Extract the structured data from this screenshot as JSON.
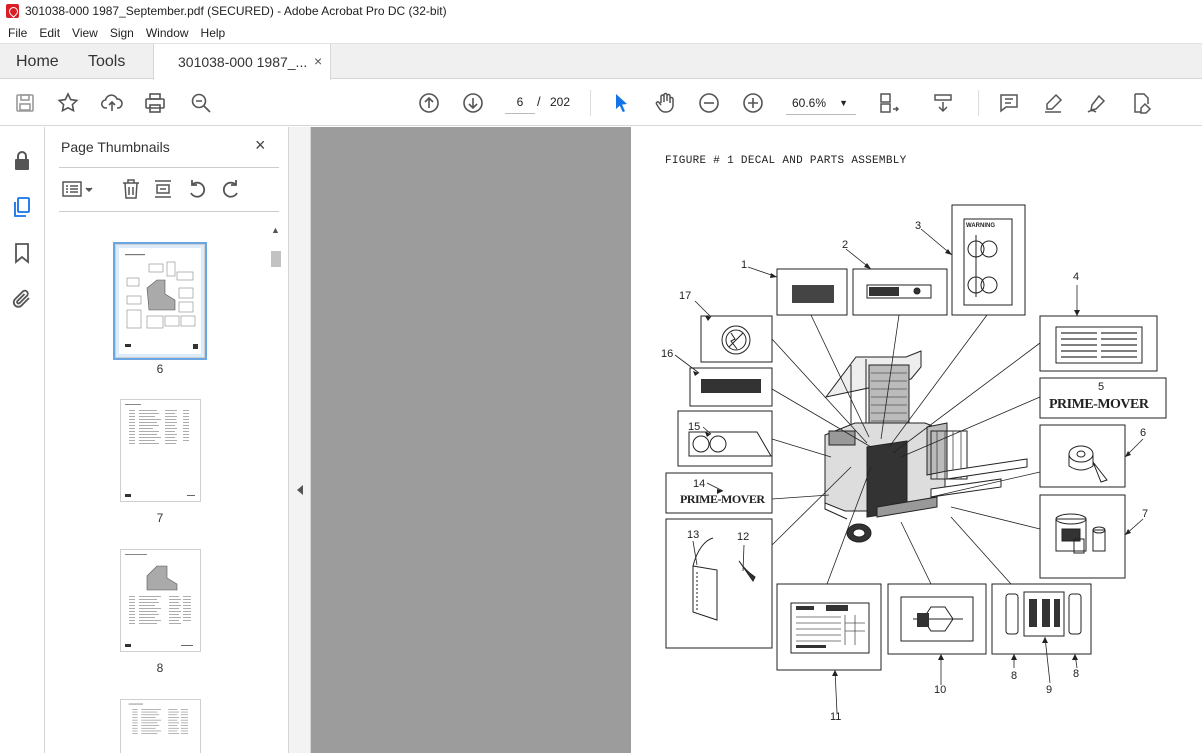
{
  "window": {
    "title": "301038-000 1987_September.pdf (SECURED) - Adobe Acrobat Pro DC (32-bit)"
  },
  "menu": [
    "File",
    "Edit",
    "View",
    "Sign",
    "Window",
    "Help"
  ],
  "tabs": {
    "home": "Home",
    "tools": "Tools",
    "document": "301038-000 1987_...",
    "close": "×"
  },
  "toolbar": {
    "page_current": "6",
    "page_separator": "/",
    "page_total": "202",
    "zoom": "60.6%"
  },
  "thumbnails_panel": {
    "title": "Page Thumbnails",
    "close": "×",
    "pages": [
      {
        "label": "6",
        "selected": true
      },
      {
        "label": "7",
        "selected": false
      },
      {
        "label": "8",
        "selected": false
      }
    ]
  },
  "document": {
    "figure_title": "FIGURE # 1 DECAL AND PARTS ASSEMBLY",
    "callouts": [
      "1",
      "2",
      "3",
      "4",
      "5",
      "6",
      "7",
      "8",
      "9",
      "8",
      "10",
      "11",
      "12",
      "13",
      "14",
      "15",
      "16",
      "17"
    ],
    "brand_text": "PRIME-MOVER",
    "warning_text": "WARNING"
  },
  "icons": {
    "save": "save-icon",
    "bookmark": "star-icon",
    "upload": "upload-icon",
    "print": "print-icon",
    "find": "magnify-minus-icon",
    "prev": "arrow-up-circle-icon",
    "next": "arrow-down-circle-icon",
    "select": "pointer-icon",
    "hand": "hand-icon",
    "zoom_out": "zoom-out-icon",
    "zoom_in": "zoom-in-icon"
  },
  "colors": {
    "accent": "#1473e6",
    "pdf_red": "#d81f26",
    "viewer_bg": "#9c9c9c"
  }
}
